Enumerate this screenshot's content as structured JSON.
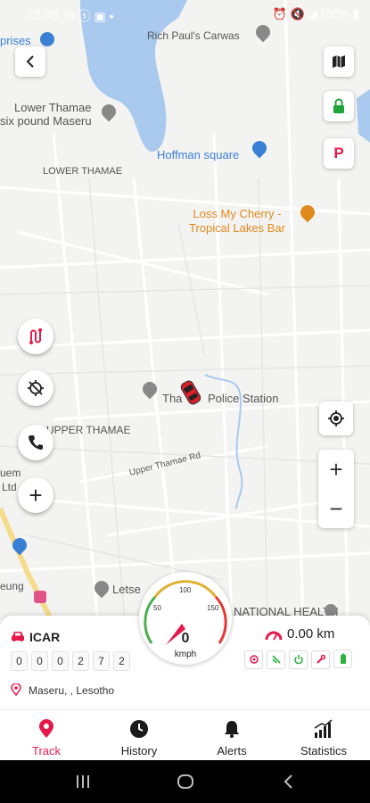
{
  "status_bar": {
    "time": "22:08",
    "battery": "100%"
  },
  "map": {
    "labels": {
      "prises": "prises",
      "rich_pauls": "Rich Paul's Carwas",
      "lower_thamae_pound_1": "Lower Thamae",
      "lower_thamae_pound_2": "six pound Maseru",
      "hoffman": "Hoffman square",
      "lower_thamae": "LOWER THAMAE",
      "loss_cherry_1": "Loss My Cherry -",
      "loss_cherry_2": "Tropical Lakes Bar",
      "police_a": "Tha",
      "police_b": "Police Station",
      "upper_thamae": "UPPER THAMAE",
      "upper_thamae_rd": "Upper Thamae Rd",
      "uem": "uem",
      "ltd": "Ltd",
      "eung": "eung",
      "letse": "Letse",
      "national_health": "NATIONAL HEALTH"
    },
    "parking_label": "P",
    "map_controls": {
      "zoom_in": "+",
      "zoom_out": "−"
    },
    "side_buttons": {
      "add": "+"
    }
  },
  "speedometer": {
    "ticks": [
      "50",
      "100",
      "150"
    ],
    "speed": "0",
    "unit": "kmph"
  },
  "vehicle_panel": {
    "name": "ICAR",
    "odometer_digits": [
      "0",
      "0",
      "0",
      "2",
      "7",
      "2"
    ],
    "distance": "0.00 km",
    "location": "Maseru, , Lesotho",
    "colors": {
      "accent": "#e6194b",
      "ok": "#2fb344"
    }
  },
  "tabs": [
    {
      "label": "Track",
      "icon": "map-pin-icon",
      "active": true
    },
    {
      "label": "History",
      "icon": "clock-icon",
      "active": false
    },
    {
      "label": "Alerts",
      "icon": "bell-icon",
      "active": false
    },
    {
      "label": "Statistics",
      "icon": "signal-bars-icon",
      "active": false
    }
  ]
}
